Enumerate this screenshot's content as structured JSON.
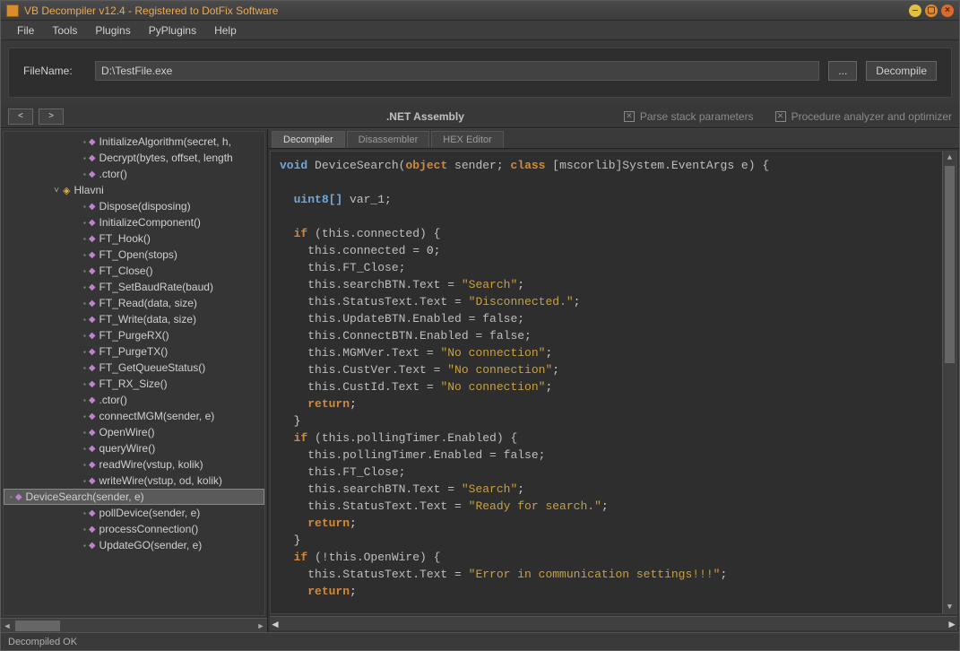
{
  "titlebar": {
    "title": "VB Decompiler v12.4 - Registered to DotFix Software"
  },
  "menu": [
    "File",
    "Tools",
    "Plugins",
    "PyPlugins",
    "Help"
  ],
  "file": {
    "label": "FileName:",
    "path": "D:\\TestFile.exe",
    "browse": "...",
    "decompile": "Decompile"
  },
  "nav": {
    "assembly": ".NET Assembly",
    "parse_stack": "Parse stack parameters",
    "analyzer": "Procedure analyzer and optimizer"
  },
  "tree": {
    "top": [
      "InitializeAlgorithm(secret, h,",
      "Decrypt(bytes, offset, length",
      ".ctor()"
    ],
    "class_name": "Hlavni",
    "methods": [
      "Dispose(disposing)",
      "InitializeComponent()",
      "FT_Hook()",
      "FT_Open(stops)",
      "FT_Close()",
      "FT_SetBaudRate(baud)",
      "FT_Read(data, size)",
      "FT_Write(data, size)",
      "FT_PurgeRX()",
      "FT_PurgeTX()",
      "FT_GetQueueStatus()",
      "FT_RX_Size()",
      ".ctor()",
      "connectMGM(sender, e)",
      "OpenWire()",
      "queryWire()",
      "readWire(vstup, kolik)",
      "writeWire(vstup, od, kolik)",
      "DeviceSearch(sender, e)",
      "pollDevice(sender, e)",
      "processConnection()",
      "UpdateGO(sender, e)"
    ],
    "selected_index": 18
  },
  "tabs": [
    "Decompiler",
    "Disassembler",
    "HEX Editor"
  ],
  "active_tab": 0,
  "code": {
    "sig_void": "void",
    "sig_name": " DeviceSearch(",
    "sig_object": "object",
    "sig_sender": " sender; ",
    "sig_class": "class",
    "sig_rest": " [mscorlib]System.EventArgs e) {",
    "decl_type": "uint8[]",
    "decl_var": " var_1;",
    "if": "if",
    "return": "return",
    "cond1": " (this.connected) {",
    "b1_l1": "    this.connected = ",
    "b1_l1_num": "0",
    "b1_l2": "    this.FT_Close;",
    "b1_l3a": "    this.searchBTN.Text = ",
    "b1_l3b": "\"Search\"",
    "b1_l4a": "    this.StatusText.Text = ",
    "b1_l4b": "\"Disconnected.\"",
    "b1_l5": "    this.UpdateBTN.Enabled = false;",
    "b1_l6": "    this.ConnectBTN.Enabled = false;",
    "b1_l7a": "    this.MGMVer.Text = ",
    "b1_noconn": "\"No connection\"",
    "b1_l8a": "    this.CustVer.Text = ",
    "b1_l9a": "    this.CustId.Text = ",
    "cond2": " (this.pollingTimer.Enabled) {",
    "b2_l1": "    this.pollingTimer.Enabled = false;",
    "b2_l2": "    this.FT_Close;",
    "b2_l3a": "    this.searchBTN.Text = ",
    "b2_l4a": "    this.StatusText.Text = ",
    "b2_l4b": "\"Ready for search.\"",
    "cond3": " (!this.OpenWire) {",
    "b3_l1a": "    this.StatusText.Text = ",
    "b3_l1b": "\"Error in communication settings!!!\""
  },
  "status": "Decompiled OK"
}
